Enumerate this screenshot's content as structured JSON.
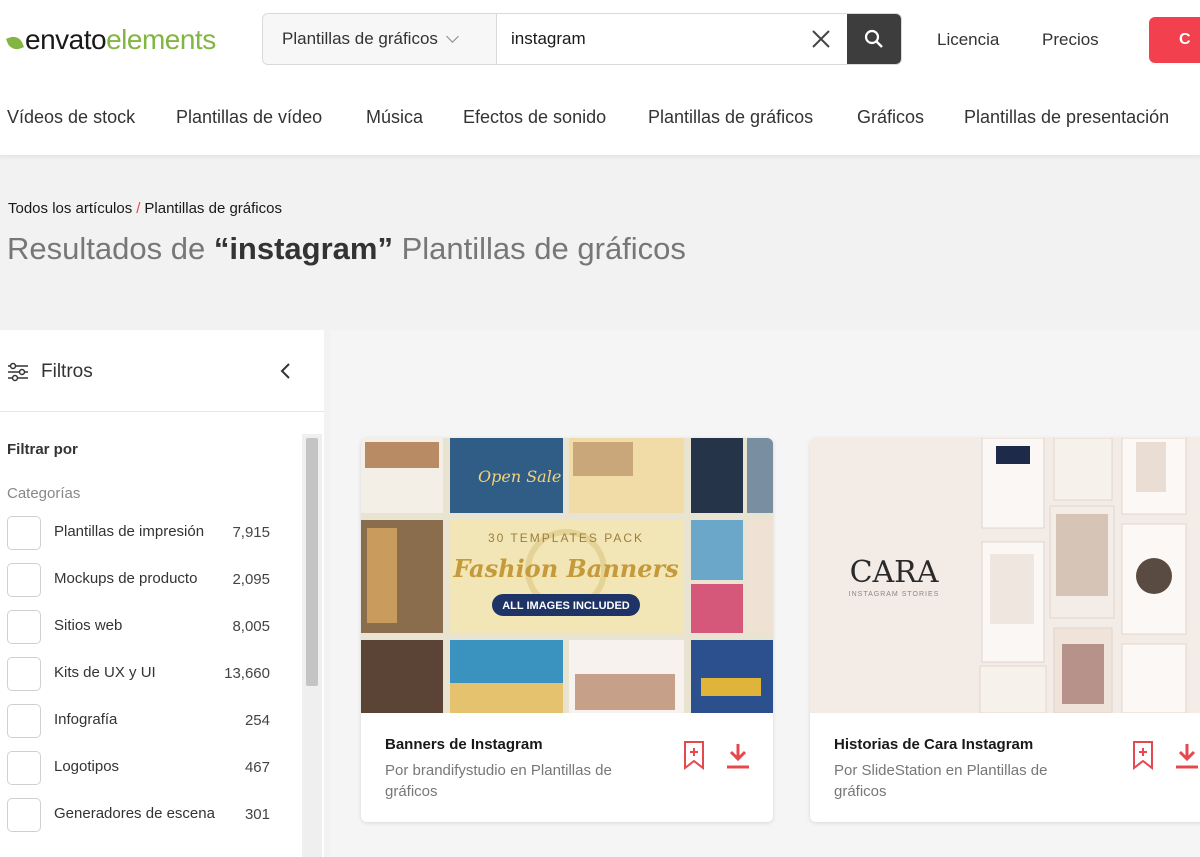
{
  "header": {
    "logo_envato": "envato",
    "logo_elements": "elements",
    "search_category": "Plantillas de gráficos",
    "search_value": "instagram",
    "links": [
      "Licencia",
      "Precios"
    ],
    "cta_label": "C"
  },
  "catnav": [
    "Vídeos de stock",
    "Plantillas de vídeo",
    "Música",
    "Efectos de sonido",
    "Plantillas de gráficos",
    "Gráficos",
    "Plantillas de presentación"
  ],
  "breadcrumb": {
    "root": "Todos los artículos",
    "sep": "/",
    "current": "Plantillas de gráficos"
  },
  "title": {
    "prefix": "Resultados de",
    "query": "“instagram”",
    "suffix": "Plantillas de gráficos"
  },
  "filters": {
    "title": "Filtros",
    "filter_by": "Filtrar por",
    "categories_label": "Categorías",
    "categories": [
      {
        "name": "Plantillas de impresión",
        "count": "7,915"
      },
      {
        "name": "Mockups de producto",
        "count": "2,095"
      },
      {
        "name": "Sitios web",
        "count": "8,005"
      },
      {
        "name": "Kits de UX y UI",
        "count": "13,660"
      },
      {
        "name": "Infografía",
        "count": "254"
      },
      {
        "name": "Logotipos",
        "count": "467"
      },
      {
        "name": "Generadores de escena",
        "count": "301"
      }
    ]
  },
  "results": [
    {
      "title": "Banners de Instagram",
      "author": "Por brandifystudio en Plantillas de gráficos",
      "thumb_text": {
        "sale": "Open Sale",
        "pack": "30 TEMPLATES PACK",
        "headline": "Fashion Banners",
        "badge": "ALL IMAGES INCLUDED"
      }
    },
    {
      "title": "Historias de Cara Instagram",
      "author": "Por SlideStation en Plantillas de gráficos",
      "thumb_text": {
        "brand": "CARA",
        "sub": "INSTAGRAM STORIES"
      }
    }
  ],
  "colors": {
    "brand_green": "#82b541",
    "cta_red": "#f2404f",
    "accent_red": "#e5484d",
    "search_dark": "#3d3d3d"
  },
  "icons": [
    "leaf-logo-icon",
    "chevron-down-icon",
    "close-icon",
    "search-icon",
    "filter-sliders-icon",
    "chevron-left-icon",
    "bookmark-icon",
    "download-icon"
  ]
}
